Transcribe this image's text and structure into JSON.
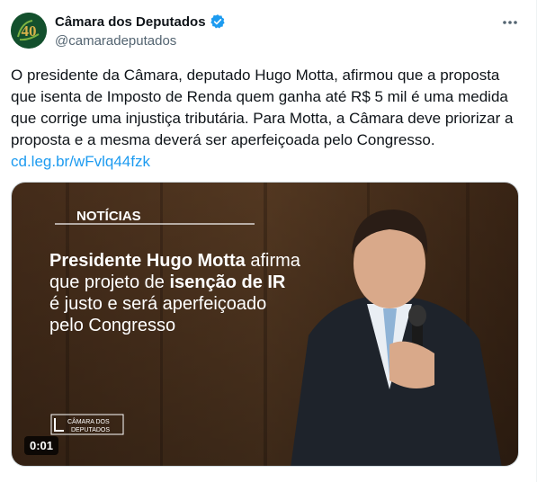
{
  "author": {
    "name": "Câmara dos Deputados",
    "handle": "@camaradeputados",
    "avatar_text": "40"
  },
  "post": {
    "text": "O presidente da Câmara, deputado Hugo Motta, afirmou que a proposta que isenta de Imposto de Renda quem ganha até R$ 5 mil é uma medida que corrige uma injustiça tributária. Para Motta, a Câmara deve priorizar a proposta e a mesma deverá ser aperfeiçoada pelo Congresso.",
    "link": "cd.leg.br/wFvlq44fzk"
  },
  "video": {
    "kicker": "NOTÍCIAS",
    "headline_bold1": "Presidente Hugo Motta",
    "headline_regular1": " afirma",
    "headline_regular2": "que projeto de ",
    "headline_bold2": "isenção de IR",
    "headline_regular3": "é justo e será aperfeiçoado",
    "headline_regular4": "pelo Congresso",
    "logo_line1": "CÂMARA DOS",
    "logo_line2": "DEPUTADOS",
    "timestamp": "0:01"
  },
  "colors": {
    "verified": "#1d9bf0",
    "link": "#1d9bf0",
    "avatar_bg": "#13502d",
    "avatar_gold": "#d9b24a"
  },
  "icons": {
    "verified": "verified-badge-icon",
    "more": "more-horizontal-icon"
  }
}
